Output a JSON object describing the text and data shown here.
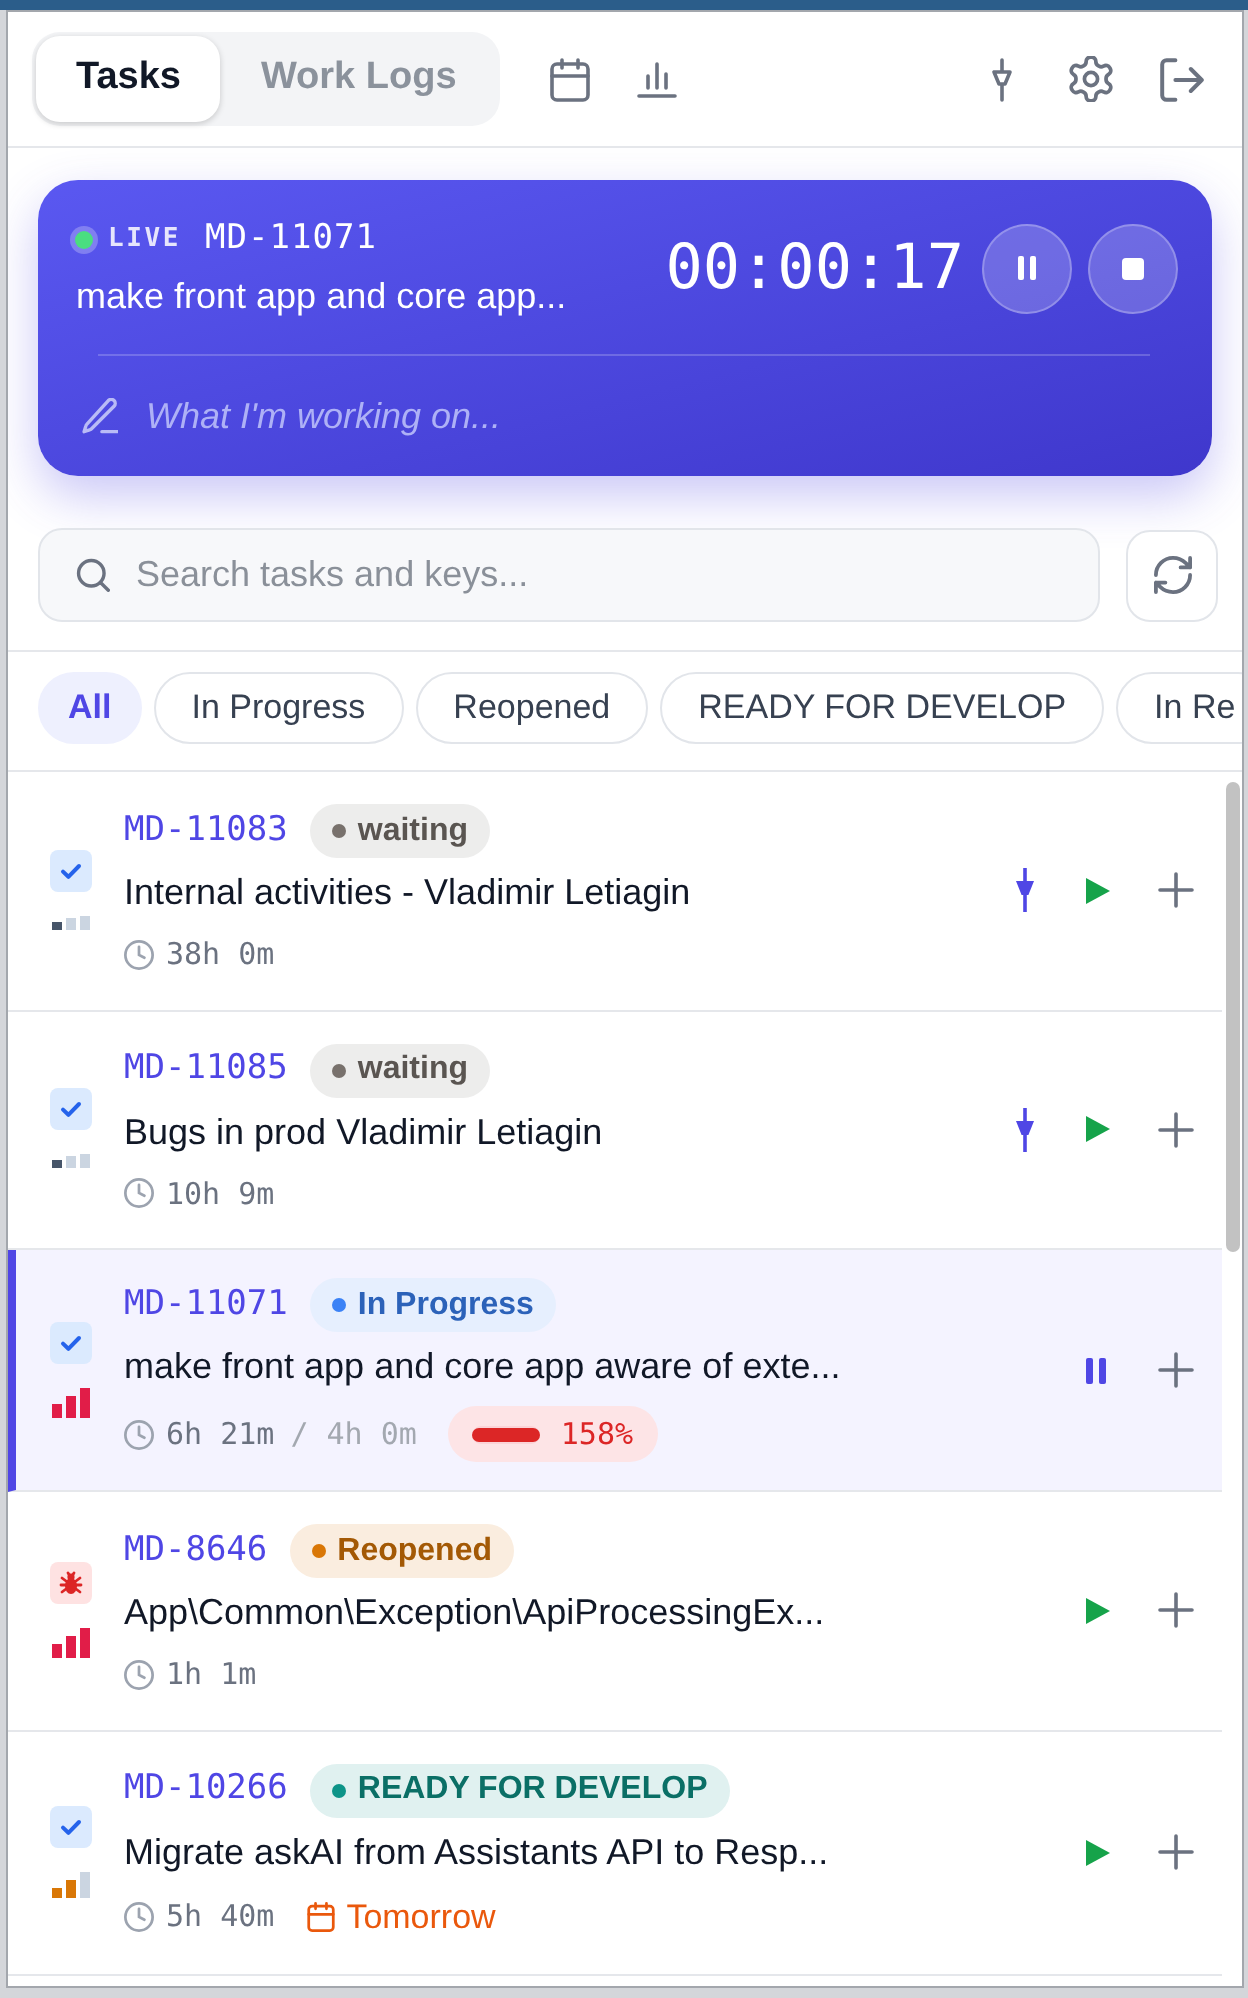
{
  "tabs": [
    {
      "label": "Tasks",
      "selected": true
    },
    {
      "label": "Work Logs",
      "selected": false
    }
  ],
  "live": {
    "label": "LIVE",
    "key": "MD-11071",
    "title": "make front app and core app...",
    "timer": "00:00:17",
    "note": {
      "placeholder": "What I'm working on..."
    }
  },
  "search": {
    "placeholder": "Search tasks and keys..."
  },
  "filters": [
    {
      "label": "All",
      "selected": true
    },
    {
      "label": "In Progress",
      "selected": false
    },
    {
      "label": "Reopened",
      "selected": false
    },
    {
      "label": "READY FOR DEVELOP",
      "selected": false
    },
    {
      "label": "In Re",
      "selected": false
    }
  ],
  "tasks": [
    {
      "kind": "task",
      "priority": {
        "level": 0.33
      },
      "key": "MD-11083",
      "status": {
        "label": "waiting",
        "color": "#78716c"
      },
      "title": "Internal activities - Vladimir Letiagin",
      "time": "38h 0m",
      "pinned": true,
      "running": false
    },
    {
      "kind": "task",
      "priority": {
        "level": 0.33
      },
      "key": "MD-11085",
      "status": {
        "label": "waiting",
        "color": "#78716c"
      },
      "title": "Bugs in prod Vladimir Letiagin",
      "time": "10h 9m",
      "pinned": true,
      "running": false
    },
    {
      "kind": "task",
      "priority": {
        "level": 1
      },
      "key": "MD-11071",
      "status": {
        "label": "In Progress",
        "color": "#3b82f6"
      },
      "title": "make front app and core app aware of exte...",
      "time": "6h 21m",
      "estimate": "/ 4h 0m",
      "overrun": {
        "level": 1,
        "reading": "158%"
      },
      "pinned": false,
      "running": true
    },
    {
      "kind": "bug",
      "priority": {
        "level": 1
      },
      "key": "MD-8646",
      "status": {
        "label": "Reopened",
        "color": "#d97706"
      },
      "title": "App\\Common\\Exception\\ApiProcessingEx...",
      "time": "1h 1m",
      "pinned": false,
      "running": false
    },
    {
      "kind": "task",
      "priority": {
        "level": 0.67
      },
      "key": "MD-10266",
      "status": {
        "label": "READY FOR DEVELOP",
        "color": "#0d9488"
      },
      "title": "Migrate askAI from Assistants API to Resp...",
      "time": "5h 40m",
      "due": "Tomorrow",
      "pinned": false,
      "running": false
    }
  ]
}
